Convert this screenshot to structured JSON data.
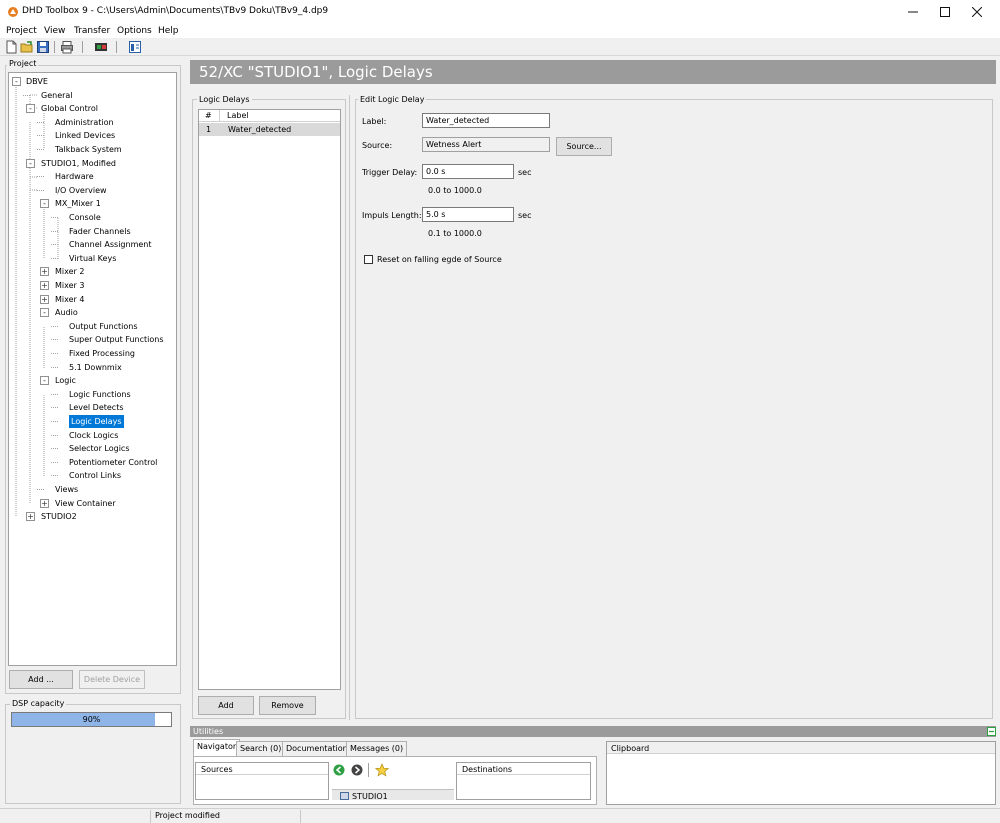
{
  "window": {
    "title": "DHD Toolbox 9 - C:\\Users\\Admin\\Documents\\TBv9 Doku\\TBv9_4.dp9",
    "controls": [
      "minimize",
      "maximize",
      "close"
    ]
  },
  "menu": [
    "Project",
    "View",
    "Transfer",
    "Options",
    "Help"
  ],
  "toolbar": {
    "icons": [
      "new-file-icon",
      "open-folder-icon",
      "save-icon",
      "print-icon",
      "transfer-icon",
      "view-icon"
    ]
  },
  "project": {
    "group_label": "Project",
    "tree": [
      {
        "label": "DBVE",
        "expander": "-"
      },
      {
        "label": "General"
      },
      {
        "label": "Global Control",
        "expander": "-"
      },
      {
        "label": "Administration"
      },
      {
        "label": "Linked Devices"
      },
      {
        "label": "Talkback System"
      },
      {
        "label": "STUDIO1, Modified",
        "expander": "-"
      },
      {
        "label": "Hardware"
      },
      {
        "label": "I/O Overview"
      },
      {
        "label": "MX_Mixer 1",
        "expander": "-"
      },
      {
        "label": "Console"
      },
      {
        "label": "Fader Channels"
      },
      {
        "label": "Channel Assignment"
      },
      {
        "label": "Virtual Keys"
      },
      {
        "label": "Mixer 2",
        "expander": "+"
      },
      {
        "label": "Mixer 3",
        "expander": "+"
      },
      {
        "label": "Mixer 4",
        "expander": "+"
      },
      {
        "label": "Audio",
        "expander": "-"
      },
      {
        "label": "Output Functions"
      },
      {
        "label": "Super Output Functions"
      },
      {
        "label": "Fixed Processing"
      },
      {
        "label": "5.1 Downmix"
      },
      {
        "label": "Logic",
        "expander": "-"
      },
      {
        "label": "Logic Functions"
      },
      {
        "label": "Level Detects"
      },
      {
        "label": "Logic Delays",
        "selected": true
      },
      {
        "label": "Clock Logics"
      },
      {
        "label": "Selector Logics"
      },
      {
        "label": "Potentiometer Control"
      },
      {
        "label": "Control Links"
      },
      {
        "label": "Views"
      },
      {
        "label": "View Container",
        "expander": "+"
      },
      {
        "label": "STUDIO2",
        "expander": "+"
      }
    ],
    "add_button": "Add ...",
    "delete_button": "Delete Device"
  },
  "dsp": {
    "label": "DSP capacity",
    "value_text": "90%",
    "fraction": 0.9
  },
  "header": {
    "title": "52/XC \"STUDIO1\", Logic Delays"
  },
  "logic_delays": {
    "group_label": "Logic Delays",
    "columns": [
      "#",
      "Label"
    ],
    "rows": [
      {
        "num": "1",
        "label": "Water_detected"
      }
    ],
    "add_button": "Add",
    "remove_button": "Remove"
  },
  "edit": {
    "group_label": "Edit Logic Delay",
    "label_caption": "Label:",
    "label_value": "Water_detected",
    "source_caption": "Source:",
    "source_value": "Wetness Alert",
    "source_button": "Source...",
    "trigger_caption": "Trigger Delay:",
    "trigger_value": "0.0 s",
    "trigger_unit": "sec",
    "trigger_range": "0.0 to 1000.0",
    "impuls_caption": "Impuls Length:",
    "impuls_value": "5.0 s",
    "impuls_unit": "sec",
    "impuls_range": "0.1 to 1000.0",
    "reset_checkbox_label": "Reset on falling egde of Source",
    "reset_checked": false
  },
  "utilities": {
    "title": "Utilities",
    "tabs": [
      "Navigator",
      "Search (0)",
      "Documentation",
      "Messages (0)"
    ],
    "active_tab": "Navigator",
    "sources_header": "Sources",
    "destinations_header": "Destinations",
    "nav_item": "STUDIO1",
    "clipboard_header": "Clipboard"
  },
  "status": {
    "text": "Project modified"
  }
}
